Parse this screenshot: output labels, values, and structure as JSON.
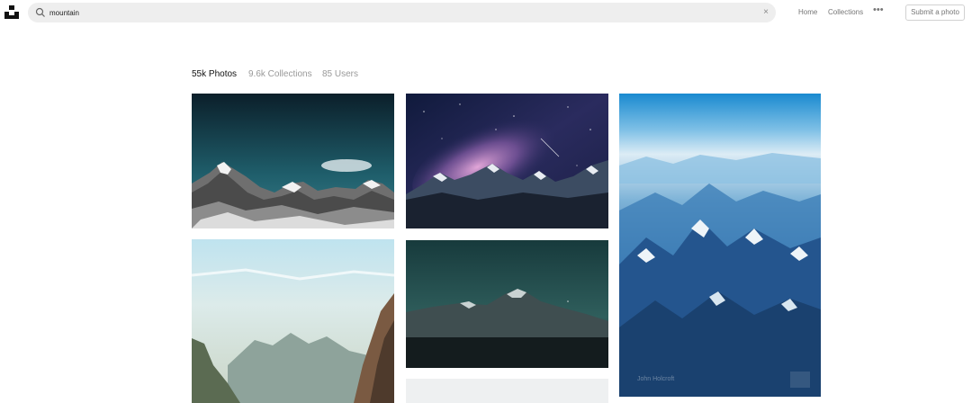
{
  "header": {
    "search": {
      "value": "mountain",
      "clear_icon": "×",
      "icon": "search-icon"
    },
    "nav": {
      "home": "Home",
      "collections": "Collections",
      "more": "•••"
    },
    "submit_label": "Submit a photo"
  },
  "tabs": [
    {
      "label": "55k Photos",
      "active": true
    },
    {
      "label": "9.6k Collections",
      "active": false
    },
    {
      "label": "85 Users",
      "active": false
    }
  ],
  "photos": [
    {
      "subject": "snowy-mountain-ridge-dark-sky"
    },
    {
      "subject": "milky-way-over-mountains"
    },
    {
      "subject": "aerial-blue-mountains",
      "author": "John Holcroft"
    },
    {
      "subject": "misty-cliffs"
    },
    {
      "subject": "dark-teal-mountain-peak"
    },
    {
      "subject": "partial-light-photo"
    }
  ],
  "colors": {
    "accent": "#111111",
    "muted": "#767676",
    "search_bg": "#eeeeee"
  }
}
